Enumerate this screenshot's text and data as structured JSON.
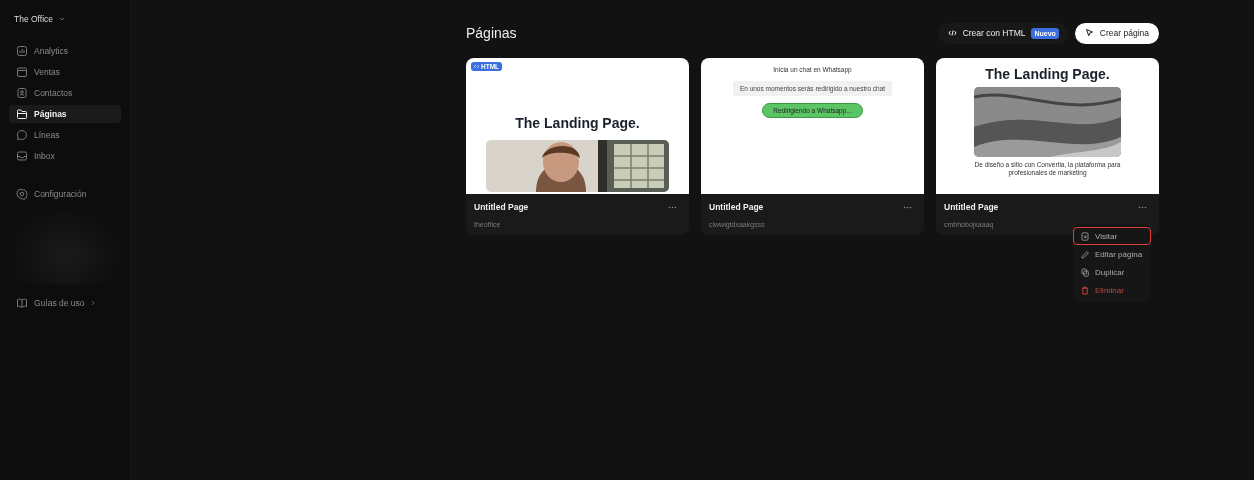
{
  "workspace": {
    "name": "The Office"
  },
  "sidebar": {
    "items": [
      {
        "label": "Analytics",
        "selected": false
      },
      {
        "label": "Ventas",
        "selected": false
      },
      {
        "label": "Contactos",
        "selected": false
      },
      {
        "label": "Páginas",
        "selected": true
      },
      {
        "label": "Líneas",
        "selected": false
      },
      {
        "label": "Inbox",
        "selected": false
      }
    ],
    "settings": {
      "label": "Configuración"
    },
    "guides": {
      "label": "Guías de uso"
    }
  },
  "header": {
    "title": "Páginas",
    "html_button": {
      "label": "Crear con HTML",
      "badge": "Nuevo"
    },
    "create_button": {
      "label": "Crear página"
    }
  },
  "pages": [
    {
      "title": "Untitled Page",
      "slug": "theoffice",
      "preview": [
        {
          "kind": "badge",
          "text": "HTML"
        },
        {
          "kind": "heading",
          "text": "The Landing Page."
        },
        {
          "kind": "picture"
        }
      ]
    },
    {
      "title": "Untitled Page",
      "slug": "clwwigtdxaakgsss",
      "preview": [
        {
          "kind": "text",
          "text": "Inicia un chat en Whatsapp"
        },
        {
          "kind": "notice",
          "text": "En unos momentos serás redirigido a nuestro chat"
        },
        {
          "kind": "button",
          "text": "Redirigiendo a Whatsapp..."
        }
      ]
    },
    {
      "title": "Untitled Page",
      "slug": "cmbhobojxaaaq",
      "preview": [
        {
          "kind": "heading",
          "text": "The Landing Page."
        },
        {
          "kind": "picture"
        },
        {
          "kind": "text",
          "text": "De diseño a sitio con Convertia, la plataforma para profesionales de marketing"
        }
      ],
      "menu_open": true
    }
  ],
  "menu": {
    "items": [
      {
        "label": "Visitar",
        "kind": "visit",
        "highlighted": true
      },
      {
        "label": "Editar página",
        "kind": "edit",
        "highlighted": false
      },
      {
        "label": "Duplicar",
        "kind": "copy",
        "highlighted": false
      },
      {
        "label": "Eliminar",
        "kind": "delete",
        "highlighted": false
      }
    ]
  }
}
